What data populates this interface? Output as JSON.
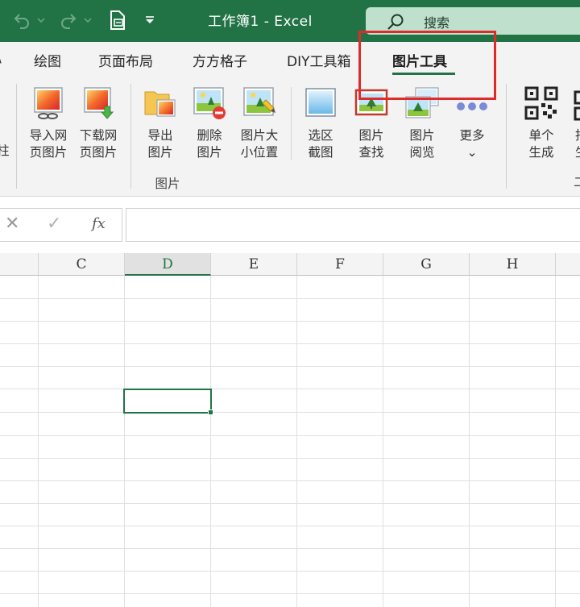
{
  "titlebar": {
    "title": "工作簿1  -  Excel",
    "search_label": "搜索",
    "accent": "#217346"
  },
  "tabs": [
    {
      "label": "绘图"
    },
    {
      "label": "页面布局"
    },
    {
      "label": "方方格子"
    },
    {
      "label": "DIY工具箱"
    },
    {
      "label": "图片工具",
      "active": true
    }
  ],
  "ribbon": {
    "left_cut_label": "\n柱",
    "buttons": [
      {
        "label": "导入网\n页图片",
        "icon": "import-web-image-icon"
      },
      {
        "label": "下载网\n页图片",
        "icon": "download-web-image-icon"
      },
      {
        "label": "导出\n图片",
        "icon": "export-image-icon"
      },
      {
        "label": "删除\n图片",
        "icon": "delete-image-icon"
      },
      {
        "label": "图片大\n小位置",
        "icon": "image-size-position-icon"
      },
      {
        "label": "选区\n截图",
        "icon": "selection-screenshot-icon"
      },
      {
        "label": "图片\n查找",
        "icon": "image-find-icon"
      },
      {
        "label": "图片\n阅览",
        "icon": "image-browse-icon"
      },
      {
        "label": "更多\n⌄",
        "icon": "more-dots-icon"
      },
      {
        "label": "单个\n生成",
        "icon": "qr-code-icon"
      }
    ],
    "group_label": "图片",
    "right_cut_label": "批\n生"
  },
  "formula_bar": {
    "cancel": "✕",
    "enter": "✓",
    "fx": "fx",
    "value": ""
  },
  "grid": {
    "columns": [
      "C",
      "D",
      "E",
      "F",
      "G",
      "H"
    ],
    "selected_column": "D"
  },
  "highlight_color": "#e02b2b"
}
